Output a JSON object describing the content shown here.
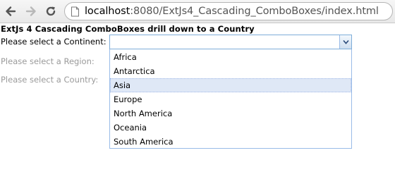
{
  "browser": {
    "url_host": "localhost",
    "url_rest": ":8080/ExtJs4_Cascading_ComboBoxes/index.html",
    "back_icon": "arrow-left-icon",
    "forward_icon": "arrow-right-icon",
    "reload_icon": "reload-icon",
    "page_icon": "page-icon"
  },
  "page": {
    "title": "ExtJs 4 Cascading ComboBoxes drill down to a Country"
  },
  "form": {
    "continent_label": "Please select a Continent:",
    "region_label": "Please select a Region:",
    "country_label": "Please select a Country:",
    "continent_value": ""
  },
  "dropdown": {
    "items": [
      {
        "label": "Africa"
      },
      {
        "label": "Antarctica"
      },
      {
        "label": "Asia",
        "selected": true
      },
      {
        "label": "Europe"
      },
      {
        "label": "North America"
      },
      {
        "label": "Oceania"
      },
      {
        "label": "South America"
      }
    ]
  },
  "colors": {
    "combo_border": "#7eadd9",
    "selected_bg": "#dfe8f6",
    "disabled_label": "#9a9a9a"
  }
}
